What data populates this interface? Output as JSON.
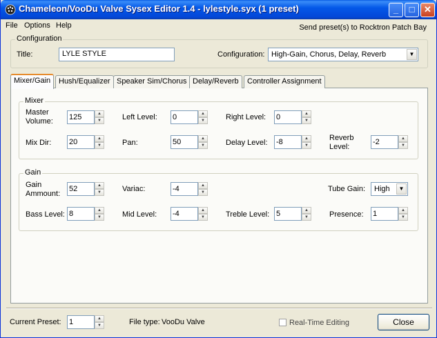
{
  "window": {
    "title": "Chameleon/VooDu Valve Sysex Editor 1.4 - lylestyle.syx (1 preset)",
    "minimize_glyph": "_",
    "maximize_glyph": "□",
    "close_glyph": "✕"
  },
  "menu": {
    "file": "File",
    "options": "Options",
    "help": "Help"
  },
  "send_link": "Send preset(s) to Rocktron Patch Bay",
  "configuration": {
    "group_label": "Configuration",
    "title_label": "Title:",
    "title_value": "LYLE STYLE",
    "config_label": "Configuration:",
    "config_value": "High-Gain, Chorus, Delay, Reverb"
  },
  "tabs": [
    {
      "label": "Mixer/Gain",
      "active": true
    },
    {
      "label": "Hush/Equalizer"
    },
    {
      "label": "Speaker Sim/Chorus"
    },
    {
      "label": "Delay/Reverb"
    },
    {
      "label": "Controller Assignment"
    }
  ],
  "mixer": {
    "group_label": "Mixer",
    "master_volume": {
      "label1": "Master",
      "label2": "Volume:",
      "value": "125"
    },
    "left_level": {
      "label": "Left Level:",
      "value": "0"
    },
    "right_level": {
      "label": "Right Level:",
      "value": "0"
    },
    "mix_dir": {
      "label": "Mix Dir:",
      "value": "20"
    },
    "pan": {
      "label": "Pan:",
      "value": "50"
    },
    "delay_level": {
      "label": "Delay Level:",
      "value": "-8"
    },
    "reverb_level": {
      "label1": "Reverb",
      "label2": "Level:",
      "value": "-2"
    }
  },
  "gain": {
    "group_label": "Gain",
    "gain_amount": {
      "label1": "Gain",
      "label2": "Ammount:",
      "value": "52"
    },
    "variac": {
      "label": "Variac:",
      "value": "-4"
    },
    "tube_gain": {
      "label": "Tube Gain:",
      "value": "High"
    },
    "bass_level": {
      "label": "Bass Level:",
      "value": "8"
    },
    "mid_level": {
      "label": "Mid Level:",
      "value": "-4"
    },
    "treble_level": {
      "label": "Treble Level:",
      "value": "5"
    },
    "presence": {
      "label": "Presence:",
      "value": "1"
    }
  },
  "footer": {
    "current_preset_label": "Current Preset:",
    "current_preset_value": "1",
    "file_type_label": "File type:",
    "file_type_value": "VooDu Valve",
    "realtime_label": "Real-Time Editing",
    "close_label": "Close"
  },
  "glyphs": {
    "spin_up": "▲",
    "spin_down": "▼",
    "dropdown": "▼"
  }
}
